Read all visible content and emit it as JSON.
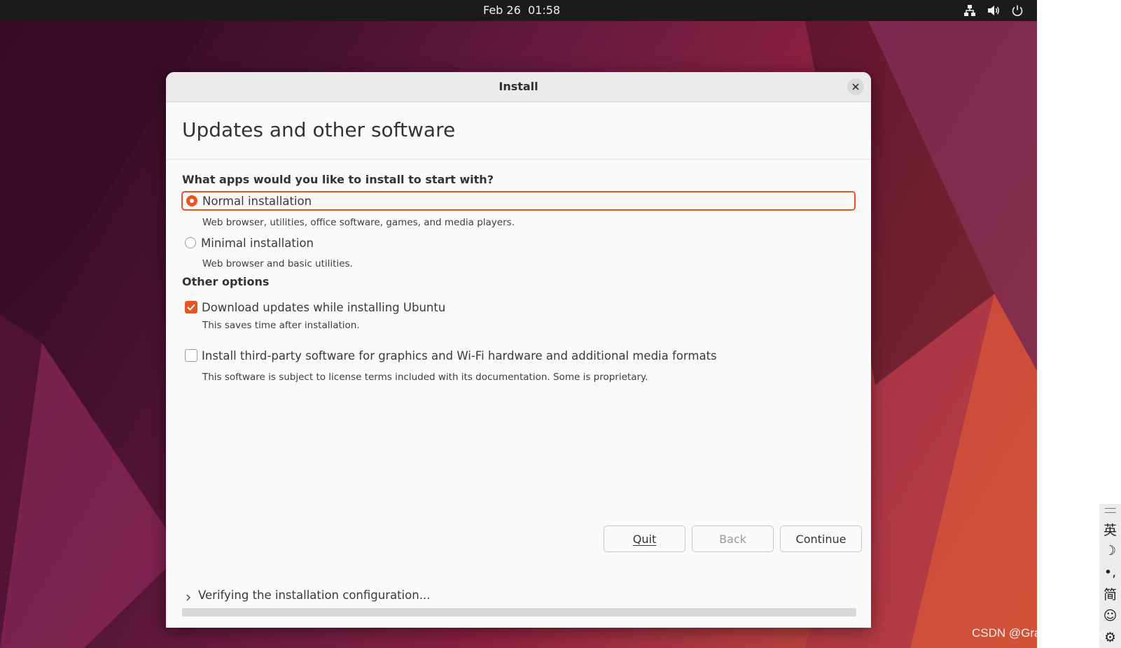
{
  "topbar": {
    "date": "Feb 26",
    "time": "01:58",
    "tray_icons": [
      "network-icon",
      "volume-icon",
      "power-icon"
    ]
  },
  "window": {
    "title": "Install"
  },
  "page": {
    "title": "Updates and other software"
  },
  "question": {
    "label": "What apps would you like to install to start with?"
  },
  "options": [
    {
      "label": "Normal installation",
      "description": "Web browser, utilities, office software, games, and media players.",
      "selected": true
    },
    {
      "label": "Minimal installation",
      "description": "Web browser and basic utilities.",
      "selected": false
    }
  ],
  "other_options": {
    "heading": "Other options",
    "items": [
      {
        "label": "Download updates while installing Ubuntu",
        "description": "This saves time after installation.",
        "checked": true
      },
      {
        "label": "Install third-party software for graphics and Wi-Fi hardware and additional media formats",
        "description": "This software is subject to license terms included with its documentation. Some is proprietary.",
        "checked": false
      }
    ]
  },
  "buttons": {
    "quit": "Quit",
    "back": "Back",
    "continue": "Continue"
  },
  "status": {
    "text": "Verifying the installation configuration...",
    "progress": 0
  },
  "ime": {
    "items": [
      "英",
      "☽",
      "•,",
      "简",
      "☺",
      "⚙"
    ]
  },
  "watermark": "CSDN @Grayson_Zheng",
  "colors": {
    "accent": "#e95420",
    "topbar": "#1b1b1b",
    "dialog": "#fafafa"
  }
}
